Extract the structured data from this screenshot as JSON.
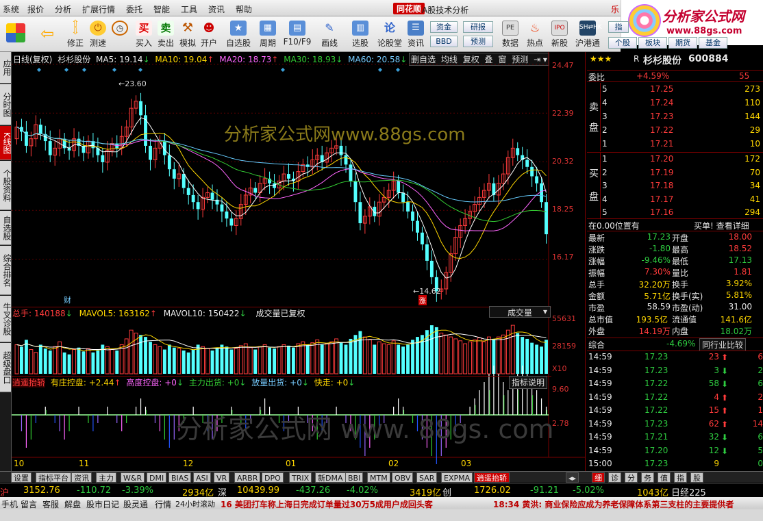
{
  "menu": {
    "items": [
      "系统",
      "报价",
      "分析",
      "扩展行情",
      "委托",
      "智能",
      "工具",
      "资讯",
      "帮助"
    ],
    "brand": "同花顺",
    "title": "A股技术分析",
    "partial_right": "乐"
  },
  "logo": {
    "title": "分析家公式网",
    "url": "www.88gs.com"
  },
  "toolbar": {
    "buttons": [
      "修正",
      "测速",
      "买入",
      "卖出",
      "模拟",
      "开户",
      "自选股",
      "周期",
      "F10/F9",
      "画线",
      "选股",
      "论股堂",
      "资讯",
      "数据",
      "热点",
      "新股",
      "沪港通"
    ],
    "buy_icon": "买",
    "sell_icon": "卖",
    "right_buttons": [
      "资金",
      "BBD",
      "研报",
      "预测",
      "指",
      "个股",
      "板块",
      "期货",
      "基金"
    ]
  },
  "sidebar": [
    "应用",
    "分时图",
    "K线图",
    "个股资料",
    "自选股",
    "综合排名",
    "牛叉诊股",
    "超级盘口"
  ],
  "chart": {
    "header": {
      "period": "日线(复权)",
      "stock": "杉杉股份",
      "ma5": "MA5: 19.14",
      "ma10": "MA10: 19.04",
      "ma20": "MA20: 18.73",
      "ma30": "MA30: 18.93",
      "ma60": "MA60: 20.58",
      "buttons": [
        "删自选",
        "均线",
        "复权",
        "叠",
        "窗",
        "预测"
      ]
    },
    "watermark1": "分析家公式网www.88gs.com",
    "watermark2": "分析家公式网 www. 88gs. com",
    "high_label": "23.60",
    "low_label": "14.62",
    "cai_label": "财",
    "zhang_label": "涨",
    "price_axis": [
      "24.47",
      "22.39",
      "20.32",
      "18.25",
      "16.17"
    ],
    "volume": {
      "label": "总手",
      "value": "140188",
      "mavol5": "MAVOL5: 163162",
      "mavol10": "MAVOL10: 150422",
      "note": "成交量已复权",
      "dropdown": "成交量",
      "axis": [
        "55631",
        "28159"
      ],
      "unit": "X10"
    },
    "indicator": {
      "name": "逍遥抬轿",
      "items": [
        "有庄控盘: +2.44",
        "高度控盘: +0",
        "主力出货: +0",
        "放量出货: +0",
        "快走: +0"
      ],
      "help": "指标说明",
      "axis": [
        "9.60",
        "2.78"
      ]
    },
    "months": [
      "10",
      "11",
      "12",
      "01",
      "02",
      "03"
    ]
  },
  "chart_data": {
    "type": "candlestick",
    "title": "杉杉股份 日线(复权)",
    "x_labels": [
      "10",
      "11",
      "12",
      "01",
      "02",
      "03"
    ],
    "ylim": [
      14.2,
      24.47
    ],
    "price_high": 23.6,
    "price_low": 14.62,
    "moving_averages": {
      "MA5": 19.14,
      "MA10": 19.04,
      "MA20": 18.73,
      "MA30": 18.93,
      "MA60": 20.58
    },
    "close": [
      21.8,
      21.6,
      21.0,
      21.3,
      21.9,
      21.5,
      21.2,
      20.6,
      20.9,
      21.3,
      20.9,
      20.8,
      21.3,
      21.0,
      20.7,
      21.2,
      20.9,
      20.6,
      20.3,
      20.8,
      21.1,
      20.9,
      21.4,
      21.8,
      22.6,
      22.9,
      22.3,
      21.0,
      20.4,
      20.9,
      21.2,
      20.6,
      20.0,
      19.6,
      19.8,
      19.2,
      18.9,
      18.6,
      18.3,
      18.8,
      19.0,
      18.7,
      18.5,
      18.2,
      17.9,
      17.6,
      17.9,
      18.5,
      18.9,
      19.2,
      19.0,
      19.4,
      19.6,
      19.4,
      19.2,
      19.5,
      19.8,
      19.6,
      19.5,
      19.9,
      20.2,
      20.1,
      20.4,
      20.6,
      20.3,
      20.7,
      20.9,
      21.0,
      20.6,
      20.2,
      19.5,
      18.6,
      17.7,
      18.0,
      18.4,
      18.0,
      18.6,
      18.8,
      19.1,
      19.5,
      19.0,
      18.6,
      18.2,
      17.8,
      17.3,
      16.8,
      16.1,
      15.4,
      14.8,
      14.9,
      15.6,
      16.4,
      17.1,
      17.6,
      17.9,
      18.2,
      18.5,
      18.8,
      19.1,
      19.4,
      18.9,
      19.4,
      19.8,
      20.5,
      20.9,
      20.6,
      20.4,
      20.1,
      19.7,
      19.4,
      18.6,
      17.23
    ],
    "open": [
      21.3,
      21.8,
      21.6,
      21.0,
      21.3,
      21.9,
      21.5,
      21.2,
      20.6,
      20.9,
      21.3,
      20.9,
      20.8,
      21.3,
      21.0,
      20.7,
      21.2,
      20.9,
      20.6,
      20.3,
      20.8,
      21.1,
      20.9,
      21.4,
      21.8,
      22.6,
      22.9,
      22.3,
      21.0,
      20.4,
      20.9,
      21.2,
      20.6,
      20.0,
      19.6,
      19.8,
      19.2,
      18.9,
      18.6,
      18.3,
      18.8,
      19.0,
      18.7,
      18.5,
      18.2,
      17.9,
      17.6,
      17.9,
      18.5,
      18.9,
      19.2,
      19.0,
      19.4,
      19.6,
      19.4,
      19.2,
      19.5,
      19.8,
      19.6,
      19.5,
      19.9,
      20.2,
      20.1,
      20.4,
      20.6,
      20.3,
      20.7,
      20.9,
      21.0,
      20.6,
      20.2,
      19.5,
      18.6,
      17.7,
      18.0,
      18.4,
      18.0,
      18.6,
      18.8,
      19.1,
      19.5,
      19.0,
      18.6,
      18.2,
      17.8,
      17.3,
      16.8,
      16.1,
      15.4,
      14.8,
      14.9,
      15.6,
      16.4,
      17.1,
      17.6,
      17.9,
      18.2,
      18.5,
      18.8,
      19.1,
      19.4,
      18.9,
      19.4,
      19.8,
      20.5,
      20.9,
      20.6,
      20.4,
      20.1,
      19.7,
      19.4,
      18.6
    ],
    "volume": [
      30,
      28,
      35,
      25,
      22,
      30,
      26,
      24,
      28,
      33,
      22,
      20,
      25,
      27,
      23,
      26,
      22,
      24,
      30,
      28,
      25,
      24,
      30,
      36,
      45,
      42,
      40,
      38,
      33,
      30,
      28,
      25,
      30,
      27,
      26,
      24,
      22,
      25,
      30,
      28,
      26,
      24,
      27,
      30,
      28,
      25,
      26,
      29,
      31,
      27,
      25,
      28,
      30,
      27,
      26,
      28,
      30,
      29,
      27,
      31,
      33,
      30,
      32,
      35,
      30,
      31,
      33,
      36,
      32,
      30,
      36,
      40,
      44,
      38,
      35,
      30,
      33,
      31,
      30,
      34,
      30,
      28,
      30,
      35,
      38,
      40,
      45,
      50,
      48,
      42,
      40,
      38,
      36,
      34,
      31,
      33,
      35,
      37,
      33,
      38,
      36,
      38,
      40,
      45,
      50,
      42,
      38,
      36,
      32,
      30,
      28,
      35
    ],
    "indicator": [
      0,
      -2,
      -4,
      -3,
      -1,
      0,
      1,
      0,
      -1,
      -2,
      -3,
      -2,
      0,
      1,
      0,
      -1,
      -2,
      -1,
      0,
      1,
      0,
      -1,
      -2,
      -1,
      0,
      1,
      2,
      1,
      0,
      -1,
      -2,
      -3,
      -4,
      -3,
      -2,
      -1,
      0,
      1,
      0,
      -1,
      -2,
      -3,
      -2,
      -1,
      0,
      1,
      0,
      -1,
      -2,
      -1,
      0,
      1,
      2,
      1,
      0,
      -1,
      -2,
      -1,
      0,
      1,
      0,
      -1,
      -2,
      -3,
      -2,
      -1,
      0,
      1,
      0,
      -1,
      -2,
      -3,
      -4,
      -5,
      -4,
      -3,
      -2,
      -1,
      0,
      1,
      2,
      1,
      0,
      -1,
      -2,
      -3,
      -4,
      -5,
      -6,
      -5,
      -4,
      -3,
      -2,
      -1,
      0,
      1,
      2,
      3,
      4,
      5,
      6,
      5,
      4,
      3,
      4,
      5,
      6,
      5,
      4,
      3,
      2,
      1,
      0
    ]
  },
  "quote": {
    "stars": "★★★",
    "flag": "R",
    "name": "杉杉股份",
    "code": "600884",
    "weibi_label": "委比",
    "weibi_pct": "+4.59%",
    "weibi_val": "55",
    "sell_label": [
      "卖",
      "盘"
    ],
    "buy_label": [
      "买",
      "盘"
    ],
    "sells": [
      {
        "lvl": "5",
        "price": "17.25",
        "vol": "273"
      },
      {
        "lvl": "4",
        "price": "17.24",
        "vol": "110"
      },
      {
        "lvl": "3",
        "price": "17.23",
        "vol": "144"
      },
      {
        "lvl": "2",
        "price": "17.22",
        "vol": "29"
      },
      {
        "lvl": "1",
        "price": "17.21",
        "vol": "10"
      }
    ],
    "buys": [
      {
        "lvl": "1",
        "price": "17.20",
        "vol": "172"
      },
      {
        "lvl": "2",
        "price": "17.19",
        "vol": "70"
      },
      {
        "lvl": "3",
        "price": "17.18",
        "vol": "34"
      },
      {
        "lvl": "4",
        "price": "17.17",
        "vol": "41"
      },
      {
        "lvl": "5",
        "price": "17.16",
        "vol": "294"
      }
    ],
    "position_note": "在0.00位置有",
    "buy_note": "买单! 查看详细",
    "stats": [
      {
        "k1": "最新",
        "v1": "17.23",
        "k2": "开盘",
        "v2": "18.00"
      },
      {
        "k1": "涨跌",
        "v1": "-1.80",
        "k2": "最高",
        "v2": "18.52"
      },
      {
        "k1": "涨幅",
        "v1": "-9.46%",
        "k2": "最低",
        "v2": "17.13"
      },
      {
        "k1": "振幅",
        "v1": "7.30%",
        "k2": "量比",
        "v2": "1.81"
      },
      {
        "k1": "总手",
        "v1": "32.20万",
        "k2": "换手",
        "v2": "3.92%"
      },
      {
        "k1": "金额",
        "v1": "5.71亿",
        "k2": "换手(实)",
        "v2": "5.81%"
      },
      {
        "k1": "市盈",
        "v1": "58.59",
        "k2": "市盈(动)",
        "v2": "31.00"
      },
      {
        "k1": "总市值",
        "v1": "193.5亿",
        "k2": "流通值",
        "v2": "141.6亿"
      },
      {
        "k1": "外盘",
        "v1": "14.19万",
        "k2": "内盘",
        "v2": "18.02万"
      }
    ],
    "composite_label": "综合",
    "composite_pct": "-4.69%",
    "industry_btn": "同行业比较",
    "ticks": [
      {
        "t": "14:59",
        "p": "17.23",
        "v": "23",
        "d": "up",
        "x": "6"
      },
      {
        "t": "14:59",
        "p": "17.23",
        "v": "3",
        "d": "dn",
        "x": "2"
      },
      {
        "t": "14:59",
        "p": "17.22",
        "v": "58",
        "d": "dn",
        "x": "6"
      },
      {
        "t": "14:59",
        "p": "17.22",
        "v": "4",
        "d": "up",
        "x": "2"
      },
      {
        "t": "14:59",
        "p": "17.22",
        "v": "15",
        "d": "up",
        "x": "1"
      },
      {
        "t": "14:59",
        "p": "17.23",
        "v": "62",
        "d": "up",
        "x": "14"
      },
      {
        "t": "14:59",
        "p": "17.21",
        "v": "32",
        "d": "dn",
        "x": "6"
      },
      {
        "t": "14:59",
        "p": "17.20",
        "v": "12",
        "d": "dn",
        "x": "5"
      },
      {
        "t": "15:00",
        "p": "17.23",
        "v": "9",
        "d": "",
        "x": "0"
      }
    ],
    "right_tabs": [
      "细",
      "诊",
      "分",
      "务",
      "值",
      "指",
      "股"
    ]
  },
  "bottom_tabs": [
    "设置",
    "指标平台",
    "资讯",
    "主力",
    "W&R",
    "DMI",
    "BIAS",
    "ASI",
    "VR",
    "ARBR",
    "DPO",
    "TRIX",
    "新DMA",
    "BBI",
    "MTM",
    "OBV",
    "SAR",
    "EXPMA",
    "逍遥抬轿"
  ],
  "index_bar": {
    "sh_label": "沪",
    "sh_value": "3152.76",
    "sh_change": "-110.72",
    "sh_pct": "-3.39%",
    "sh_amount": "2934亿",
    "sz_label": "深",
    "sz_value": "10439.99",
    "sz_change": "-437.26",
    "sz_pct": "-4.02%",
    "sz_amount": "3419亿",
    "cy_label": "创",
    "cy_value": "1726.02",
    "cy_change": "-91.21",
    "cy_pct": "-5.02%",
    "cy_amount": "1043亿",
    "nk_label": "日经225"
  },
  "status_bar": {
    "items": [
      "手机",
      "留言",
      "客服",
      "解盘",
      "股市日记",
      "股灵通",
      "行情",
      "24小时滚动"
    ],
    "news1": "16 美团打车称上海日完成订单量过30万5成用户成回头客",
    "news2": "18:34 黄洪: 商业保险应成为养老保障体系第三支柱的主要提供者"
  }
}
